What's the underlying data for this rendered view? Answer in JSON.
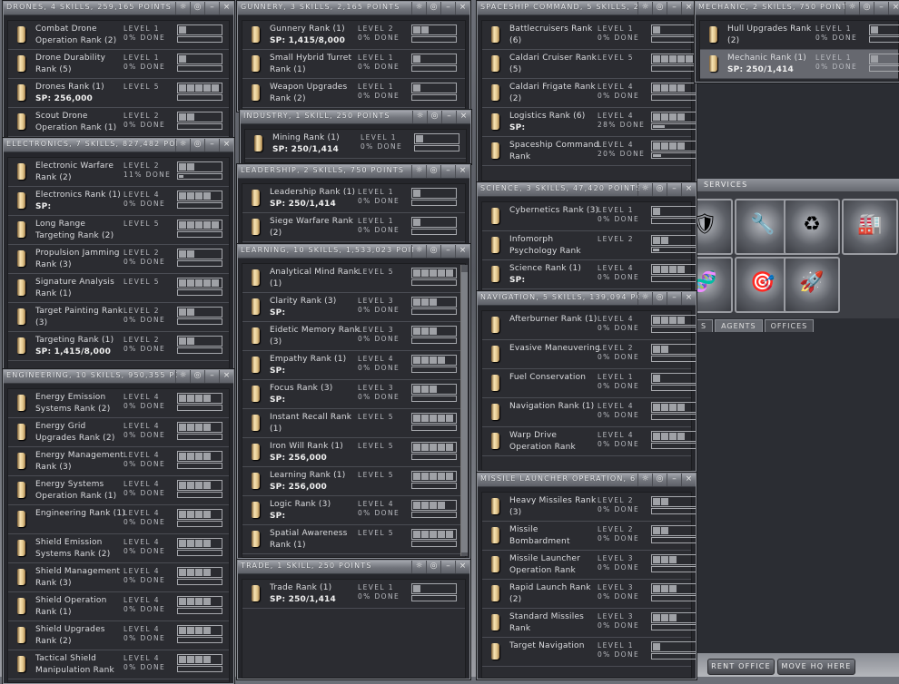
{
  "panels": [
    {
      "id": "drones",
      "title": "DRONES, 4 SKILLS, 259,165 POINTS",
      "skills": [
        {
          "name": "Combat Drone Operation Rank (2)",
          "level": "LEVEL 1",
          "level_value": 1,
          "done": "0% DONE",
          "progress": 0
        },
        {
          "name": "Drone Durability Rank (5)",
          "level": "LEVEL 1",
          "level_value": 1,
          "done": "0% DONE",
          "progress": 0
        },
        {
          "name": "Drones Rank (1)",
          "sp": "SP: 256,000",
          "level": "LEVEL 5",
          "level_value": 5,
          "progress": 0
        },
        {
          "name": "Scout Drone Operation Rank (1)",
          "level": "LEVEL 2",
          "level_value": 2,
          "done": "0% DONE",
          "progress": 0
        }
      ]
    },
    {
      "id": "electronics",
      "title": "ELECTRONICS, 7 SKILLS, 827,482 POINTS",
      "skills": [
        {
          "name": "Electronic Warfare Rank (2)",
          "level": "LEVEL 2",
          "level_value": 2,
          "done": "11% DONE",
          "progress": 0.11
        },
        {
          "name": "Electronics Rank (1)",
          "sp": "SP:",
          "level": "LEVEL 4",
          "level_value": 4,
          "done": "0% DONE",
          "progress": 0
        },
        {
          "name": "Long Range Targeting Rank (2)",
          "level": "LEVEL 5",
          "level_value": 5,
          "progress": 0
        },
        {
          "name": "Propulsion Jamming Rank (3)",
          "level": "LEVEL 2",
          "level_value": 2,
          "done": "0% DONE",
          "progress": 0
        },
        {
          "name": "Signature Analysis Rank (1)",
          "level": "LEVEL 5",
          "level_value": 5,
          "progress": 0
        },
        {
          "name": "Target Painting Rank (3)",
          "level": "LEVEL 2",
          "level_value": 2,
          "done": "0% DONE",
          "progress": 0
        },
        {
          "name": "Targeting Rank (1)",
          "sp": "SP: 1,415/8,000",
          "level": "LEVEL 2",
          "level_value": 2,
          "done": "0% DONE",
          "progress": 0
        }
      ]
    },
    {
      "id": "engineering",
      "title": "ENGINEERING, 10 SKILLS, 950,355 POINTS",
      "skills": [
        {
          "name": "Energy Emission Systems Rank (2)",
          "level": "LEVEL 4",
          "level_value": 4,
          "done": "0% DONE",
          "progress": 0
        },
        {
          "name": "Energy Grid Upgrades Rank (2)",
          "level": "LEVEL 4",
          "level_value": 4,
          "done": "0% DONE",
          "progress": 0
        },
        {
          "name": "Energy Management Rank (3)",
          "level": "LEVEL 4",
          "level_value": 4,
          "done": "0% DONE",
          "progress": 0
        },
        {
          "name": "Energy Systems Operation Rank (1)",
          "level": "LEVEL 4",
          "level_value": 4,
          "done": "0% DONE",
          "progress": 0
        },
        {
          "name": "Engineering Rank (1)",
          "level": "LEVEL 4",
          "level_value": 4,
          "done": "0% DONE",
          "progress": 0
        },
        {
          "name": "Shield Emission Systems Rank (2)",
          "level": "LEVEL 4",
          "level_value": 4,
          "done": "0% DONE",
          "progress": 0
        },
        {
          "name": "Shield Management Rank (3)",
          "level": "LEVEL 4",
          "level_value": 4,
          "done": "0% DONE",
          "progress": 0
        },
        {
          "name": "Shield Operation Rank (1)",
          "level": "LEVEL 4",
          "level_value": 4,
          "done": "0% DONE",
          "progress": 0
        },
        {
          "name": "Shield Upgrades Rank (2)",
          "level": "LEVEL 4",
          "level_value": 4,
          "done": "0% DONE",
          "progress": 0
        },
        {
          "name": "Tactical Shield Manipulation Rank",
          "level": "LEVEL 4",
          "level_value": 4,
          "done": "0% DONE",
          "progress": 0
        }
      ]
    },
    {
      "id": "gunnery",
      "title": "GUNNERY, 3 SKILLS, 2,165 POINTS",
      "skills": [
        {
          "name": "Gunnery Rank (1)",
          "sp": "SP: 1,415/8,000",
          "level": "LEVEL 2",
          "level_value": 2,
          "done": "0% DONE",
          "progress": 0
        },
        {
          "name": "Small Hybrid Turret Rank (1)",
          "level": "LEVEL 1",
          "level_value": 1,
          "done": "0% DONE",
          "progress": 0
        },
        {
          "name": "Weapon Upgrades Rank (2)",
          "level": "LEVEL 1",
          "level_value": 1,
          "done": "0% DONE",
          "progress": 0
        }
      ]
    },
    {
      "id": "industry",
      "title": "INDUSTRY, 1 SKILL, 250 POINTS",
      "skills": [
        {
          "name": "Mining Rank (1)",
          "sp": "SP: 250/1,414",
          "level": "LEVEL 1",
          "level_value": 1,
          "done": "0% DONE",
          "progress": 0
        }
      ]
    },
    {
      "id": "leadership",
      "title": "LEADERSHIP, 2 SKILLS, 750 POINTS",
      "skills": [
        {
          "name": "Leadership Rank (1)",
          "sp": "SP: 250/1,414",
          "level": "LEVEL 1",
          "level_value": 1,
          "done": "0% DONE",
          "progress": 0
        },
        {
          "name": "Siege Warfare Rank (2)",
          "level": "LEVEL 1",
          "level_value": 1,
          "done": "0% DONE",
          "progress": 0
        }
      ]
    },
    {
      "id": "learning",
      "title": "LEARNING, 10 SKILLS, 1,533,023 POINTS",
      "skills": [
        {
          "name": "Analytical Mind Rank (1)",
          "level": "LEVEL 5",
          "level_value": 5,
          "progress": 0
        },
        {
          "name": "Clarity Rank (3)",
          "sp": "SP:",
          "level": "LEVEL 3",
          "level_value": 3,
          "done": "0% DONE",
          "progress": 0
        },
        {
          "name": "Eidetic Memory Rank (3)",
          "level": "LEVEL 3",
          "level_value": 3,
          "done": "0% DONE",
          "progress": 0
        },
        {
          "name": "Empathy Rank (1)",
          "sp": "SP:",
          "level": "LEVEL 4",
          "level_value": 4,
          "done": "0% DONE",
          "progress": 0
        },
        {
          "name": "Focus Rank (3)",
          "sp": "SP:",
          "level": "LEVEL 3",
          "level_value": 3,
          "done": "0% DONE",
          "progress": 0
        },
        {
          "name": "Instant Recall Rank (1)",
          "level": "LEVEL 5",
          "level_value": 5,
          "progress": 0
        },
        {
          "name": "Iron Will Rank (1)",
          "sp": "SP: 256,000",
          "level": "LEVEL 5",
          "level_value": 5,
          "progress": 0
        },
        {
          "name": "Learning Rank (1)",
          "sp": "SP: 256,000",
          "level": "LEVEL 5",
          "level_value": 5,
          "progress": 0
        },
        {
          "name": "Logic Rank (3)",
          "sp": "SP:",
          "level": "LEVEL 4",
          "level_value": 4,
          "done": "0% DONE",
          "progress": 0
        },
        {
          "name": "Spatial Awareness Rank (1)",
          "level": "LEVEL 5",
          "level_value": 5,
          "progress": 0
        }
      ]
    },
    {
      "id": "trade",
      "title": "TRADE, 1 SKILL, 250 POINTS",
      "skills": [
        {
          "name": "Trade Rank (1)",
          "sp": "SP: 250/1,414",
          "level": "LEVEL 1",
          "level_value": 1,
          "done": "0% DONE",
          "progress": 0
        }
      ]
    },
    {
      "id": "spaceship",
      "title": "SPACESHIP COMMAND, 5 SKILLS, 2,09",
      "skills": [
        {
          "name": "Battlecruisers Rank (6)",
          "level": "LEVEL 1",
          "level_value": 1,
          "done": "0% DONE",
          "progress": 0
        },
        {
          "name": "Caldari Cruiser Rank (5)",
          "level": "LEVEL 5",
          "level_value": 5,
          "progress": 0
        },
        {
          "name": "Caldari Frigate Rank (2)",
          "level": "LEVEL 4",
          "level_value": 4,
          "done": "0% DONE",
          "progress": 0
        },
        {
          "name": "Logistics Rank (6)",
          "sp": "SP:",
          "level": "LEVEL 4",
          "level_value": 4,
          "done": "28% DONE",
          "progress": 0.28
        },
        {
          "name": "Spaceship Command Rank",
          "level": "LEVEL 4",
          "level_value": 4,
          "done": "20% DONE",
          "progress": 0.2
        }
      ]
    },
    {
      "id": "science",
      "title": "SCIENCE, 3 SKILLS, 47,420 POINTS (",
      "skills": [
        {
          "name": "Cybernetics Rank (3)",
          "level": "LEVEL 1",
          "level_value": 1,
          "done": "0% DONE",
          "progress": 0
        },
        {
          "name": "Infomorph Psychology Rank",
          "level": "LEVEL 2",
          "level_value": 2,
          "progress": 0.15
        },
        {
          "name": "Science Rank (1)",
          "sp": "SP:",
          "level": "LEVEL 4",
          "level_value": 4,
          "done": "0% DONE",
          "progress": 0
        }
      ]
    },
    {
      "id": "navigation",
      "title": "NAVIGATION, 5 SKILLS, 139,094 PO",
      "skills": [
        {
          "name": "Afterburner Rank (1)",
          "level": "LEVEL 4",
          "level_value": 4,
          "done": "0% DONE",
          "progress": 0
        },
        {
          "name": "Evasive Maneuvering",
          "level": "LEVEL 2",
          "level_value": 2,
          "done": "0% DONE",
          "progress": 0
        },
        {
          "name": "Fuel Conservation",
          "level": "LEVEL 1",
          "level_value": 1,
          "done": "0% DONE",
          "progress": 0
        },
        {
          "name": "Navigation Rank (1)",
          "level": "LEVEL 4",
          "level_value": 4,
          "done": "0% DONE",
          "progress": 0
        },
        {
          "name": "Warp Drive Operation Rank",
          "level": "LEVEL 4",
          "level_value": 4,
          "done": "0% DONE",
          "progress": 0
        }
      ]
    },
    {
      "id": "missile",
      "title": "MISSILE LAUNCHER OPERATION, 6 S",
      "skills": [
        {
          "name": "Heavy Missiles Rank (3)",
          "level": "LEVEL 2",
          "level_value": 2,
          "done": "0% DONE",
          "progress": 0
        },
        {
          "name": "Missile Bombardment",
          "level": "LEVEL 2",
          "level_value": 2,
          "done": "0% DONE",
          "progress": 0
        },
        {
          "name": "Missile Launcher Operation Rank",
          "level": "LEVEL 3",
          "level_value": 3,
          "done": "0% DONE",
          "progress": 0
        },
        {
          "name": "Rapid Launch Rank (2)",
          "level": "LEVEL 3",
          "level_value": 3,
          "done": "0% DONE",
          "progress": 0
        },
        {
          "name": "Standard Missiles Rank",
          "level": "LEVEL 3",
          "level_value": 3,
          "done": "0% DONE",
          "progress": 0
        },
        {
          "name": "Target Navigation",
          "level": "LEVEL 1",
          "level_value": 1,
          "done": "0% DONE",
          "progress": 0
        }
      ]
    },
    {
      "id": "mechanic",
      "title": "MECHANIC, 2 SKILLS, 750 POINTS",
      "skills": [
        {
          "name": "Hull Upgrades Rank (2)",
          "level": "LEVEL 1",
          "level_value": 1,
          "done": "0% DONE",
          "progress": 0
        },
        {
          "name": "Mechanic Rank (1)",
          "sp": "SP: 250/1,414",
          "level": "LEVEL 1",
          "level_value": 1,
          "done": "0% DONE",
          "progress": 0,
          "selected": true
        }
      ]
    }
  ],
  "window_buttons": {
    "pin": "☼",
    "compact": "◎",
    "minimize": "–",
    "close": "×"
  },
  "corp": {
    "services_label": "SERVICES",
    "services": [
      "repair-shop-icon",
      "fitting-icon",
      "reprocessing-icon",
      "factory-icon",
      "clone-bay-icon",
      "bounty-office-icon",
      "ship-hangar-icon"
    ],
    "tabs": [
      "S",
      "AGENTS",
      "OFFICES"
    ],
    "active_tab": "AGENTS",
    "rent_office": "RENT OFFICE",
    "move_hq": "MOVE HQ HERE"
  }
}
